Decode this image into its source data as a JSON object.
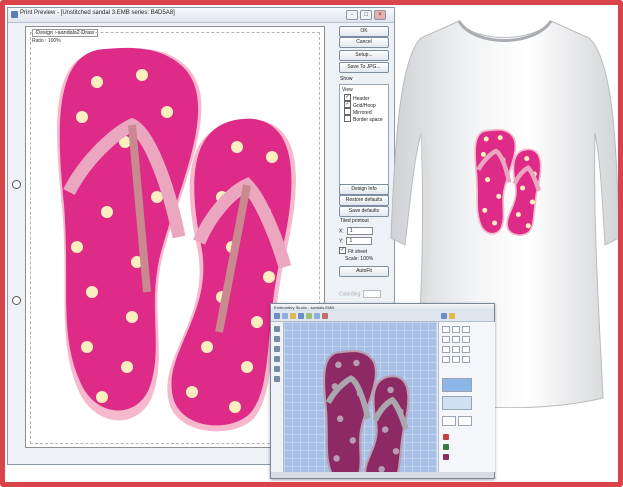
{
  "print_preview": {
    "title": "Print Preview  - [Unstitched sandal 3.EMB series: B4D5A8]",
    "window_controls": [
      "-",
      "□",
      "×"
    ],
    "paper_label": "Design : sandals2 Draw",
    "ratio_label": "Ratio : 100%",
    "buttons": {
      "ok": "OK",
      "cancel": "Cancel",
      "setup": "Setup...",
      "save_jpg": "Save To JPG...",
      "design_info": "Design Info",
      "restore": "Restore defaults",
      "save_defaults": "Save defaults",
      "autofit": "AutoFit"
    },
    "view_section": "Show",
    "view_list_header": "View",
    "checkboxes": [
      {
        "label": "Header",
        "checked": true
      },
      {
        "label": "Grid/Hoop",
        "checked": true
      },
      {
        "label": "Mirrored",
        "checked": false
      },
      {
        "label": "Border space",
        "checked": false
      }
    ],
    "tile_section": "Tiled printout",
    "spin_x_label": "X:",
    "spin_x_value": "1",
    "spin_y_label": "Y:",
    "spin_y_value": "1",
    "fit_label": "Fit sheet",
    "fit_checked": true,
    "scale_label": "Scale:",
    "scale_value": "100%",
    "color_label": "Color/bkg"
  },
  "embroidery_window": {
    "title": "Embroidery Studio - sandals.EMB"
  },
  "colors": {
    "frame_border": "#d9434a",
    "sandal_pink": "#dd2b87",
    "strap_pink": "#eaa7bf",
    "flower": "#fbefc0",
    "canvas_blue": "#a9c0e6"
  },
  "icons": [
    "window-icon",
    "minimize-icon",
    "maximize-icon",
    "close-icon"
  ]
}
